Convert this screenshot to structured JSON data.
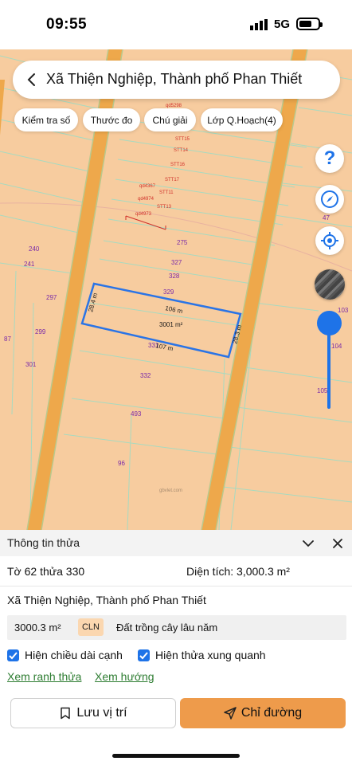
{
  "status_bar": {
    "time": "09:55",
    "network": "5G",
    "battery_level": 0.7
  },
  "search": {
    "title": "Xã Thiện Nghiệp, Thành phố Phan Thiết"
  },
  "chips": [
    {
      "label": "Kiểm tra số"
    },
    {
      "label": "Thước đo"
    },
    {
      "label": "Chú giải"
    },
    {
      "label": "Lớp Q.Hoạch(4)"
    }
  ],
  "map": {
    "plot_numbers": [
      "240",
      "241",
      "297",
      "299",
      "301",
      "87",
      "275",
      "327",
      "328",
      "329",
      "331",
      "332",
      "493",
      "96",
      "47",
      "103",
      "104",
      "105"
    ],
    "stt_labels": [
      "STT15",
      "STT14",
      "STT16",
      "STT17",
      "STT11",
      "STT13",
      "qd4367",
      "qd4974",
      "qd4973",
      "qd5298"
    ],
    "dimensions": {
      "top": "106 m",
      "bottom": "107 m",
      "left": "28.4 m",
      "right": "28.3 m",
      "area": "3001 m²"
    },
    "watermark": "gbvlet.com"
  },
  "panel": {
    "title": "Thông tin thửa",
    "parcel_id": "Tờ 62 thửa 330",
    "area_label": "Diện tích: 3,000.3 m²",
    "address": "Xã Thiện Nghiệp, Thành phố Phan Thiết",
    "land_use": {
      "area": "3000.3 m²",
      "code": "CLN",
      "name": "Đất trồng cây lâu năm"
    },
    "checks": [
      {
        "label": "Hiện chiều dài cạnh",
        "checked": true
      },
      {
        "label": "Hiện thửa xung quanh",
        "checked": true
      }
    ],
    "links": {
      "boundary": "Xem ranh thửa",
      "direction": "Xem hướng"
    },
    "buttons": {
      "save": "Lưu vị trí",
      "directions": "Chỉ đường"
    }
  },
  "colors": {
    "map_bg": "#f7cc9f",
    "road": "#eea84b",
    "selection": "#2a74e6",
    "accent": "#ee9b4b",
    "link": "#2e7d32"
  }
}
